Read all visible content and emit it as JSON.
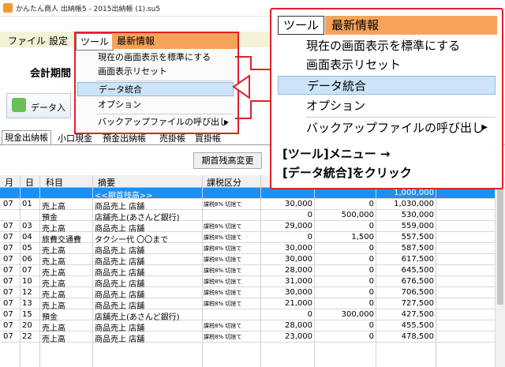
{
  "window": {
    "title": "かんたん商人 出納帳5 - 2015出納帳 (1).su5"
  },
  "menubar": {
    "file": "ファイル",
    "settings": "設定",
    "tools": "ツール",
    "news": "最新情報"
  },
  "header": {
    "company_prefix": "会計期間",
    "data_entry_button": "データ入"
  },
  "tabs": [
    "現金出納帳",
    "小口現金",
    "預金出納帳",
    "売掛帳",
    "買掛帳"
  ],
  "buttons": {
    "balance_change": "期首残高変更"
  },
  "dropdown": {
    "tool": "ツール",
    "news": "最新情報",
    "items": [
      "現在の画面表示を標準にする",
      "画面表示リセット",
      "データ統合",
      "オプション",
      "バックアップファイルの呼び出し"
    ]
  },
  "zoom_panel": {
    "tool": "ツール",
    "news": "最新情報",
    "items": [
      "現在の画面表示を標準にする",
      "画面表示リセット",
      "データ統合",
      "オプション",
      "バックアップファイルの呼び出し"
    ],
    "instruction_line1": "[ツール]メニュー →",
    "instruction_line2": "[データ統合]をクリック"
  },
  "table": {
    "headers": {
      "month": "月",
      "day": "日",
      "account": "科目",
      "description": "摘要",
      "tax": "課税区分"
    },
    "opening": {
      "label": "<<期首残高>>",
      "balance": "1,000,000"
    },
    "rows": [
      {
        "m": "07",
        "d": "01",
        "acc": "売上高",
        "desc": "商品売上 店舗",
        "tax": "課税8% 切捨て",
        "a1": "30,000",
        "a2": "0",
        "bal": "1,030,000"
      },
      {
        "m": "",
        "d": "",
        "acc": "預金",
        "desc": "店舗売上(あさんど銀行)",
        "tax": "",
        "a1": "0",
        "a2": "500,000",
        "bal": "530,000"
      },
      {
        "m": "07",
        "d": "03",
        "acc": "売上高",
        "desc": "商品売上 店舗",
        "tax": "課税8% 切捨て",
        "a1": "29,000",
        "a2": "0",
        "bal": "559,000"
      },
      {
        "m": "07",
        "d": "04",
        "acc": "旅費交通費",
        "desc": "タクシー代 〇〇まで",
        "tax": "課税8% 切捨て",
        "a1": "0",
        "a2": "1,500",
        "bal": "557,500"
      },
      {
        "m": "07",
        "d": "05",
        "acc": "売上高",
        "desc": "商品売上 店舗",
        "tax": "課税8% 切捨て",
        "a1": "30,000",
        "a2": "0",
        "bal": "587,500"
      },
      {
        "m": "07",
        "d": "06",
        "acc": "売上高",
        "desc": "商品売上 店舗",
        "tax": "課税8% 切捨て",
        "a1": "30,000",
        "a2": "0",
        "bal": "617,500"
      },
      {
        "m": "07",
        "d": "07",
        "acc": "売上高",
        "desc": "商品売上 店舗",
        "tax": "課税8% 切捨て",
        "a1": "28,000",
        "a2": "0",
        "bal": "645,500"
      },
      {
        "m": "07",
        "d": "10",
        "acc": "売上高",
        "desc": "商品売上 店舗",
        "tax": "課税8% 切捨て",
        "a1": "31,000",
        "a2": "0",
        "bal": "676,500"
      },
      {
        "m": "07",
        "d": "12",
        "acc": "売上高",
        "desc": "商品売上 店舗",
        "tax": "課税8% 切捨て",
        "a1": "30,000",
        "a2": "0",
        "bal": "706,500"
      },
      {
        "m": "07",
        "d": "13",
        "acc": "売上高",
        "desc": "商品売上 店舗",
        "tax": "課税8% 切捨て",
        "a1": "21,000",
        "a2": "0",
        "bal": "727,500"
      },
      {
        "m": "07",
        "d": "15",
        "acc": "預金",
        "desc": "店舗売上(あさんど銀行)",
        "tax": "",
        "a1": "0",
        "a2": "300,000",
        "bal": "427,500"
      },
      {
        "m": "07",
        "d": "20",
        "acc": "売上高",
        "desc": "商品売上 店舗",
        "tax": "課税8% 切捨て",
        "a1": "28,000",
        "a2": "0",
        "bal": "455,500"
      },
      {
        "m": "07",
        "d": "22",
        "acc": "売上高",
        "desc": "商品売上 店舗",
        "tax": "課税8% 切捨て",
        "a1": "23,000",
        "a2": "0",
        "bal": "478,500"
      }
    ]
  },
  "colors": {
    "accent_red": "#e0202c",
    "menu_orange": "#f6a35a",
    "highlight_blue": "#1e8ff0"
  }
}
